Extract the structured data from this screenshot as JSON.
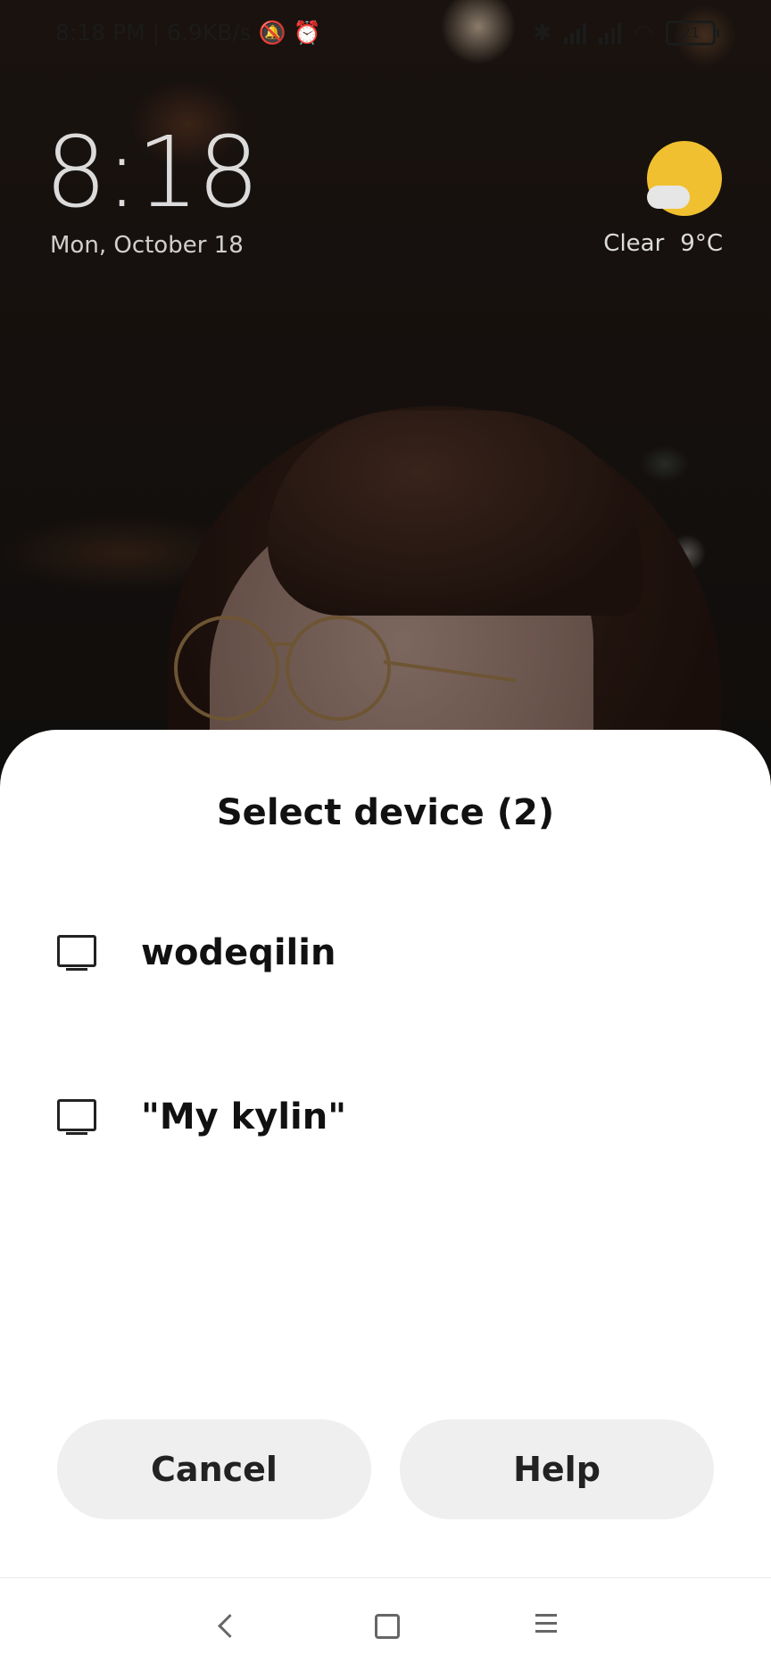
{
  "status_bar": {
    "time_speed": "8:18 PM | 6.9KB/s",
    "battery": "21"
  },
  "lockscreen": {
    "clock": "8:18",
    "date": "Mon, October 18",
    "weather_condition": "Clear",
    "temperature": "9°C"
  },
  "dialog": {
    "title": "Select device (2)",
    "devices": [
      {
        "name": "wodeqilin",
        "icon": "tv-icon"
      },
      {
        "name": "\"My kylin\"",
        "icon": "tv-icon"
      }
    ],
    "cancel_label": "Cancel",
    "help_label": "Help"
  }
}
